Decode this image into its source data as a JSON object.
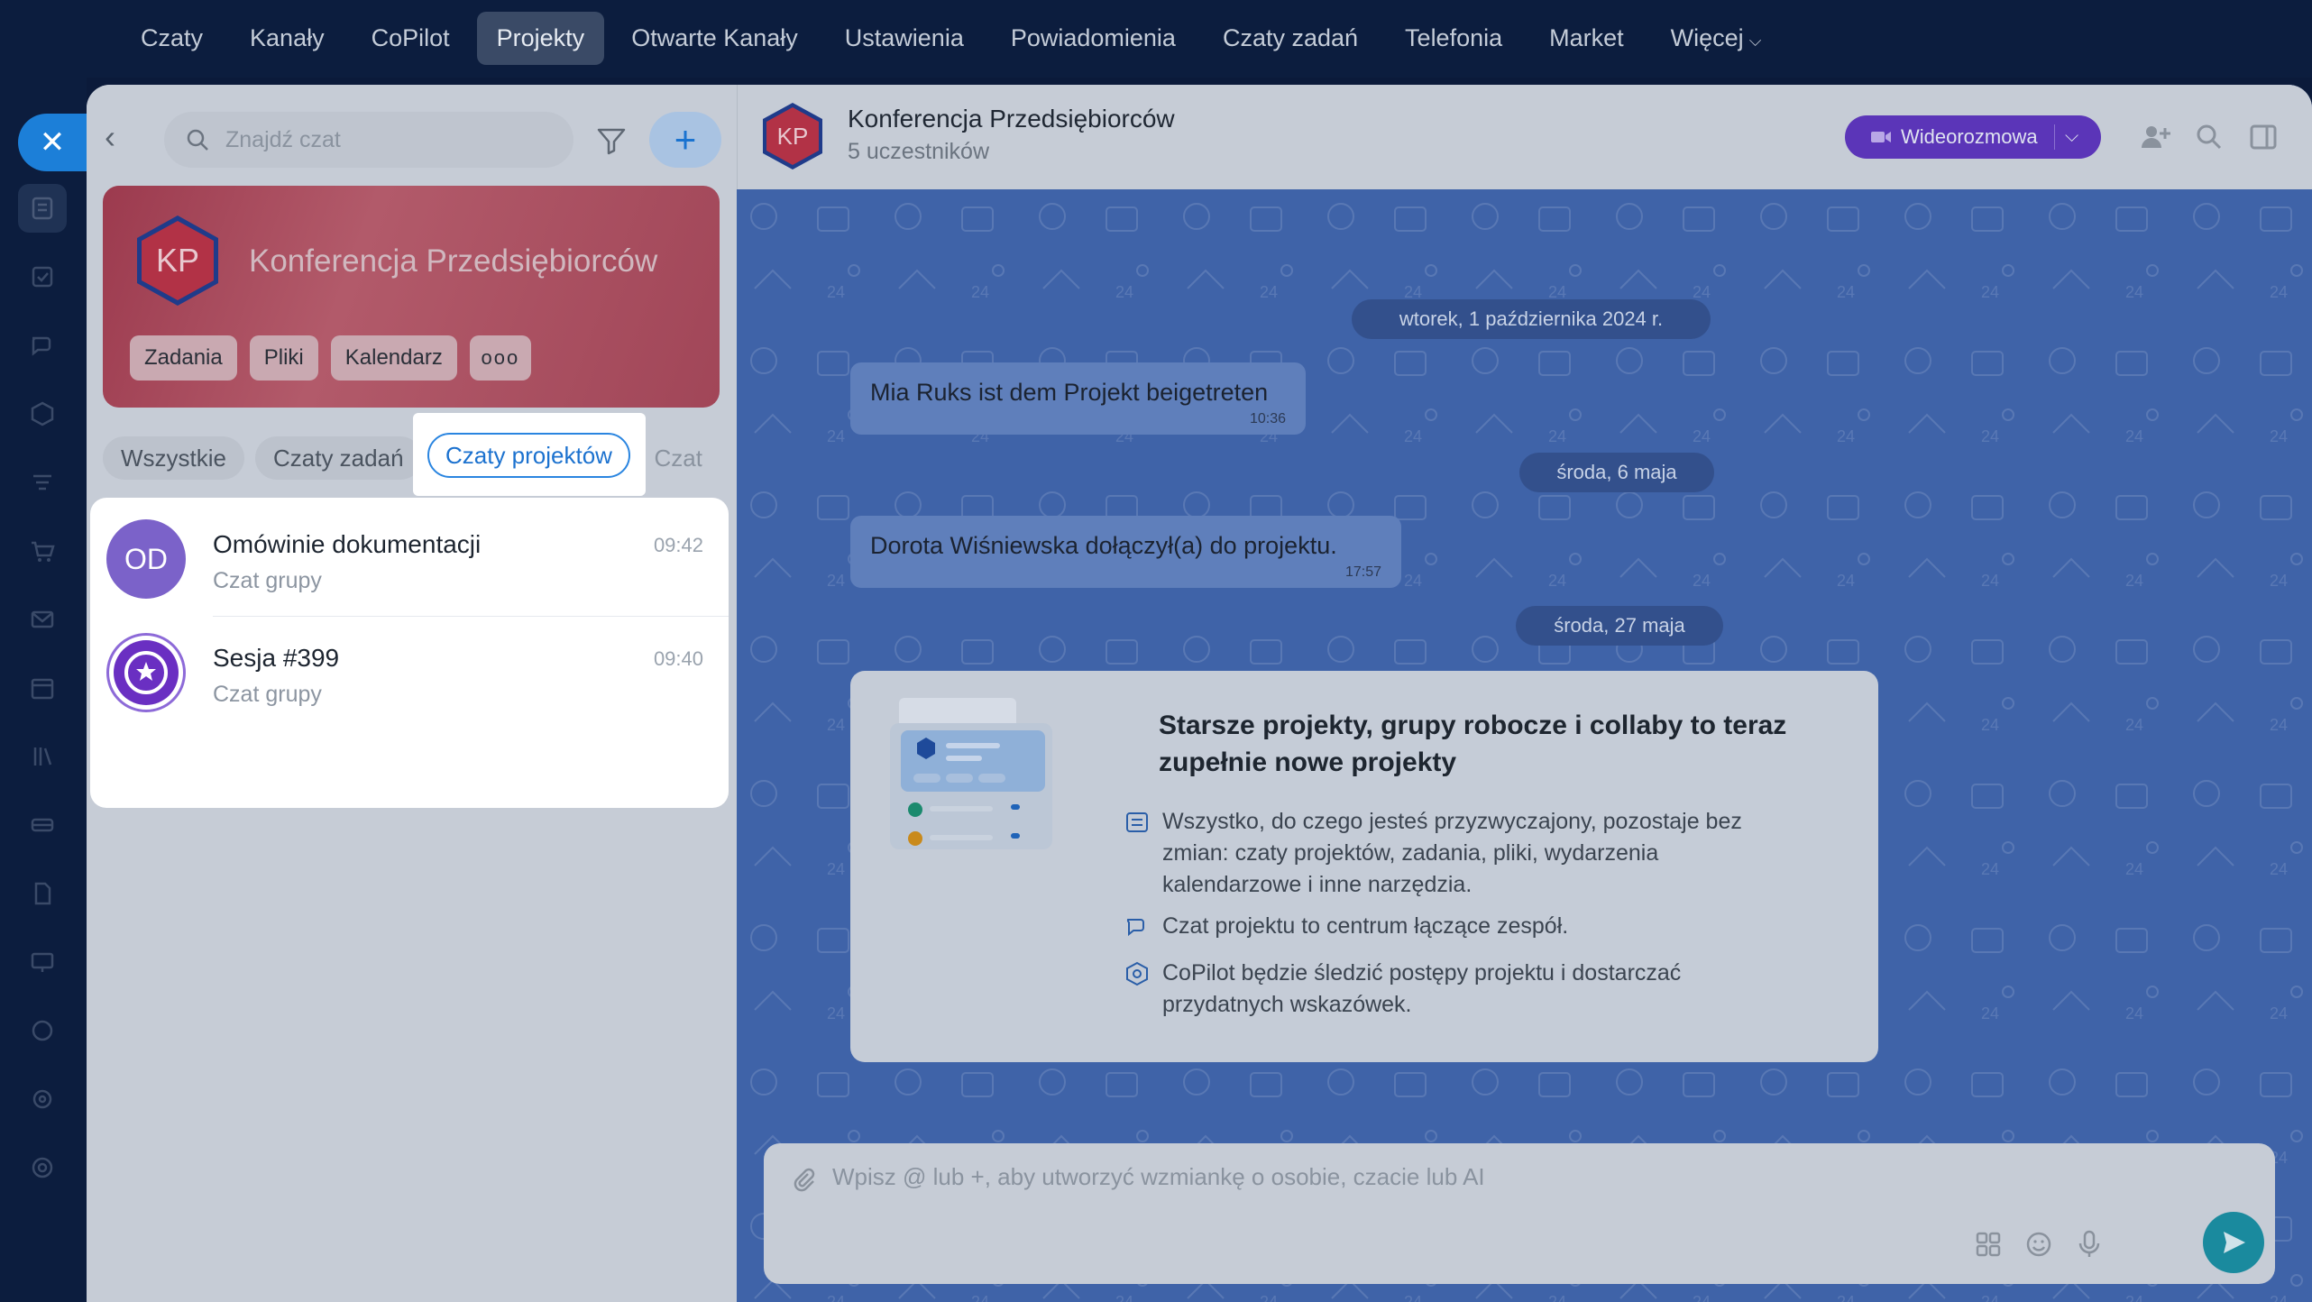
{
  "topnav": {
    "items": [
      {
        "label": "Czaty"
      },
      {
        "label": "Kanały"
      },
      {
        "label": "CoPilot"
      },
      {
        "label": "Projekty"
      },
      {
        "label": "Otwarte Kanały"
      },
      {
        "label": "Ustawienia"
      },
      {
        "label": "Powiadomienia"
      },
      {
        "label": "Czaty zadań"
      },
      {
        "label": "Telefonia"
      },
      {
        "label": "Market"
      },
      {
        "label": "Więcej"
      }
    ],
    "active": "Projekty"
  },
  "leftpanel": {
    "search_placeholder": "Znajdź czat",
    "project_card": {
      "initials": "KP",
      "title": "Konferencja Przedsiębiorców",
      "chips": [
        "Zadania",
        "Pliki",
        "Kalendarz"
      ]
    },
    "tabs": [
      "Wszystkie",
      "Czaty zadań",
      "Czaty projektów",
      "Czat"
    ],
    "active_tab": "Czaty projektów",
    "chats": [
      {
        "initials": "OD",
        "name": "Omówinie dokumentacji",
        "subtitle": "Czat grupy",
        "time": "09:42",
        "avatar_color": "#7b62c9"
      },
      {
        "initials": "",
        "name": "Sesja #399",
        "subtitle": "Czat grupy",
        "time": "09:40",
        "avatar_color": "#6a2fc2"
      }
    ]
  },
  "chat": {
    "header": {
      "initials": "KP",
      "title": "Konferencja Przedsiębiorców",
      "subtitle": "5 uczestników",
      "video_label": "Wideorozmowa"
    },
    "dates": [
      "wtorek, 1 października 2024 r.",
      "środa, 6 maja",
      "środa, 27 maja"
    ],
    "messages": [
      {
        "text": "Mia Ruks ist dem Projekt beigetreten",
        "time": "10:36"
      },
      {
        "text": "Dorota Wiśniewska dołączył(a) do projektu.",
        "time": "17:57"
      }
    ],
    "info_card": {
      "title": "Starsze projekty, grupy robocze i collaby to teraz zupełnie nowe projekty",
      "bullets": [
        "Wszystko, do czego jesteś przyzwyczajony, pozostaje bez zmian: czaty projektów, zadania, pliki, wydarzenia kalendarzowe i inne narzędzia.",
        "Czat projektu to centrum łączące zespół.",
        "CoPilot będzie śledzić postępy projektu i dostarczać przydatnych wskazówek."
      ]
    },
    "composer_placeholder": "Wpisz @ lub +, aby utworzyć wzmiankę o osobie, czacie lub AI"
  },
  "colors": {
    "nav_bg": "#0c1d3e",
    "accent_blue": "#1c72cf",
    "video_purple": "#5b35b8",
    "project_red": "#b0283c",
    "send_teal": "#1a8a9e"
  }
}
